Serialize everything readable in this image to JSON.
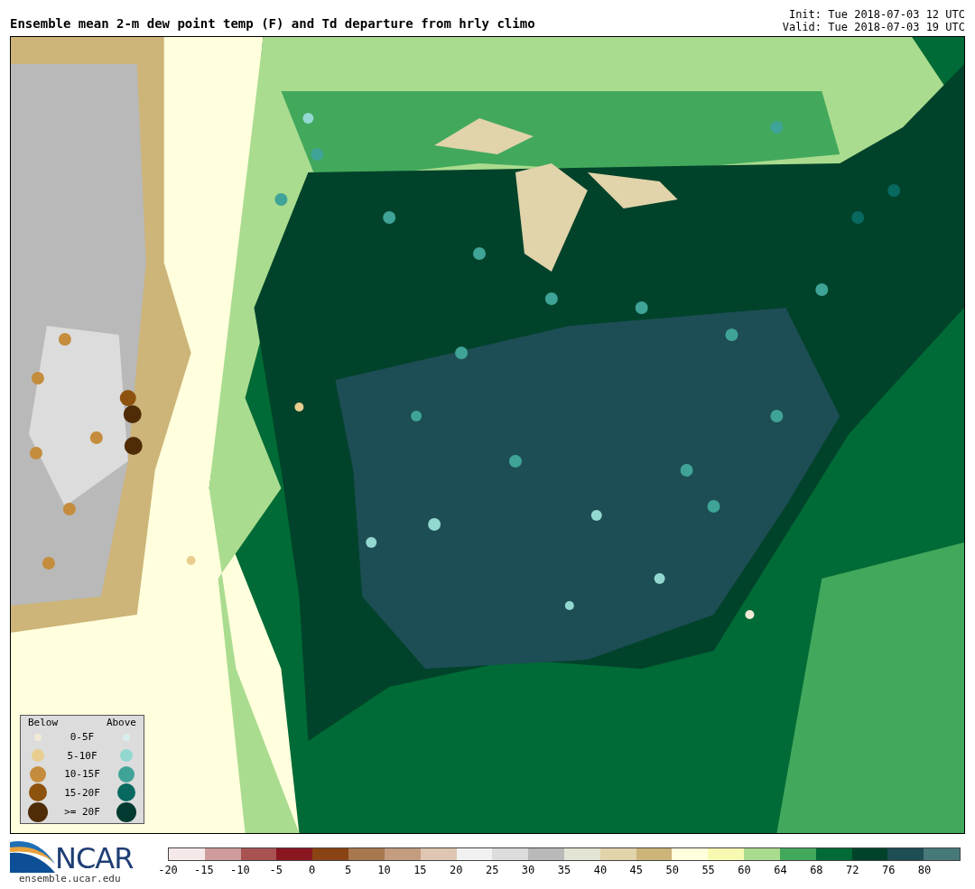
{
  "header": {
    "title": "Ensemble mean 2-m dew point temp (F) and Td departure from hrly climo",
    "init": "Init: Tue 2018-07-03 12 UTC",
    "valid": "Valid: Tue 2018-07-03 19 UTC"
  },
  "legend": {
    "below_label": "Below",
    "above_label": "Above",
    "rows": [
      {
        "label": "0-5F",
        "markers": [
          {
            "color": "#f3ead6"
          },
          {
            "color": "#d8eeee"
          }
        ]
      },
      {
        "label": "5-10F",
        "markers": [
          {
            "color": "#e8cd8e"
          },
          {
            "color": "#93d8d0"
          }
        ]
      },
      {
        "label": "10-15F",
        "markers": [
          {
            "color": "#c48c3c"
          },
          {
            "color": "#3fa497"
          }
        ]
      },
      {
        "label": "15-20F",
        "markers": [
          {
            "color": "#8e520f"
          },
          {
            "color": "#07695f"
          }
        ]
      },
      {
        "label": ">= 20F",
        "markers": [
          {
            "color": "#4f2c06"
          },
          {
            "color": "#003a30"
          }
        ]
      }
    ]
  },
  "logo": {
    "name": "NCAR",
    "url": "ensemble.ucar.edu"
  },
  "colorbar": {
    "segments": [
      {
        "color": "#f5e8e8"
      },
      {
        "color": "#cf9c9c"
      },
      {
        "color": "#a85252"
      },
      {
        "color": "#8a1620"
      },
      {
        "color": "#8a4414"
      },
      {
        "color": "#a8784f"
      },
      {
        "color": "#c49c80"
      },
      {
        "color": "#dec6b2"
      },
      {
        "color": "#f1f1f1"
      },
      {
        "color": "#dcdcdc"
      },
      {
        "color": "#b9b9b9"
      },
      {
        "color": "#e4e4d4"
      },
      {
        "color": "#e1d3aa"
      },
      {
        "color": "#cdb478"
      },
      {
        "color": "#ffffdd"
      },
      {
        "color": "#f7f9b0"
      },
      {
        "color": "#aadc8f"
      },
      {
        "color": "#42a85c"
      },
      {
        "color": "#006b36"
      },
      {
        "color": "#00432a"
      },
      {
        "color": "#1d4d55"
      },
      {
        "color": "#47797a"
      }
    ],
    "ticks": [
      "-20",
      "-15",
      "-10",
      "-5",
      "0",
      "5",
      "10",
      "15",
      "20",
      "25",
      "30",
      "35",
      "40",
      "45",
      "50",
      "55",
      "60",
      "64",
      "68",
      "72",
      "76",
      "80"
    ]
  }
}
